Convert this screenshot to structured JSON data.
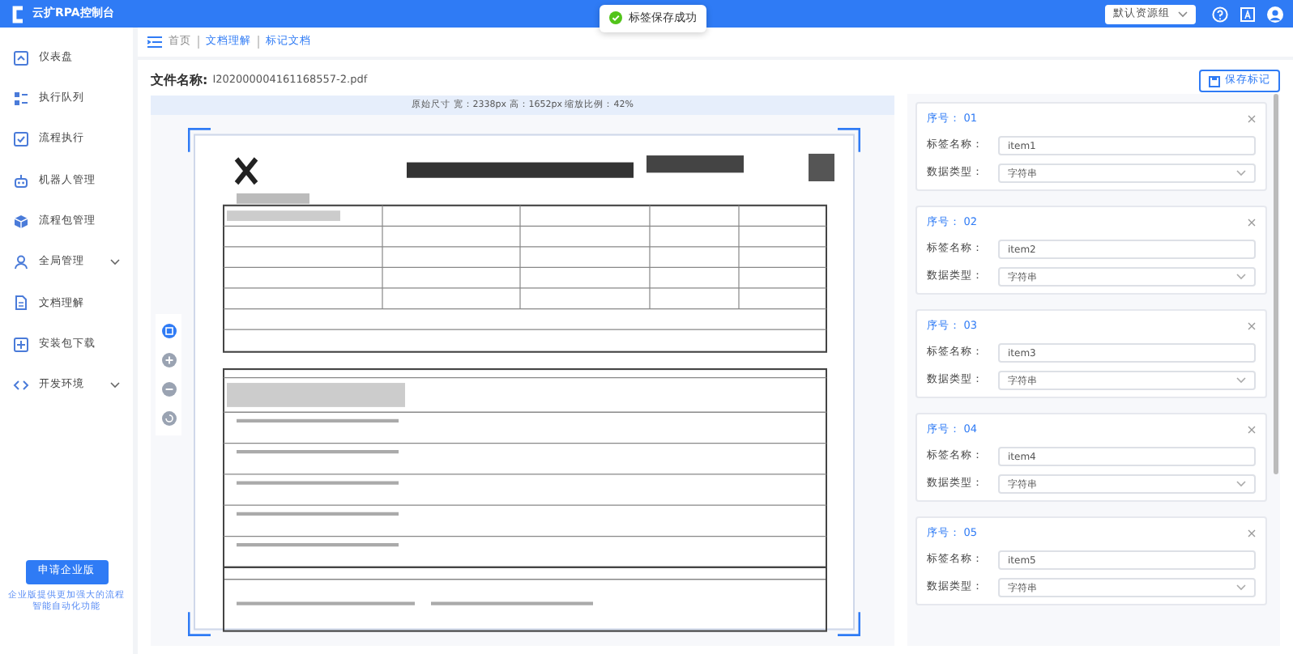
{
  "app": {
    "title": "云扩RPA控制台"
  },
  "toast": {
    "text": "标签保存成功"
  },
  "header": {
    "resource_group": "默认资源组"
  },
  "sidebar": {
    "items": [
      {
        "label": "仪表盘",
        "expandable": false
      },
      {
        "label": "执行队列",
        "expandable": false
      },
      {
        "label": "流程执行",
        "expandable": false
      },
      {
        "label": "机器人管理",
        "expandable": false
      },
      {
        "label": "流程包管理",
        "expandable": false
      },
      {
        "label": "全局管理",
        "expandable": true
      },
      {
        "label": "文档理解",
        "expandable": false
      },
      {
        "label": "安装包下载",
        "expandable": false
      },
      {
        "label": "开发环境",
        "expandable": true
      }
    ],
    "upgrade_button": "申请企业版",
    "upgrade_note": "企业版提供更加强大的流程智能自动化功能"
  },
  "breadcrumb": [
    {
      "label": "首页",
      "link": false
    },
    {
      "label": "文档理解",
      "link": true
    },
    {
      "label": "标记文档",
      "link": true
    }
  ],
  "file": {
    "label": "文件名称:",
    "name": "I202000004161168557-2.pdf"
  },
  "save_button": "保存标记",
  "image_info": "原始尺寸 宽：2338px 高：1652px 缩放比例：42%",
  "labels": [
    {
      "index_label": "序号：",
      "index": "01",
      "name_label": "标签名称：",
      "name": "item1",
      "type_label": "数据类型：",
      "type": "字符串"
    },
    {
      "index_label": "序号：",
      "index": "02",
      "name_label": "标签名称：",
      "name": "item2",
      "type_label": "数据类型：",
      "type": "字符串"
    },
    {
      "index_label": "序号：",
      "index": "03",
      "name_label": "标签名称：",
      "name": "item3",
      "type_label": "数据类型：",
      "type": "字符串"
    },
    {
      "index_label": "序号：",
      "index": "04",
      "name_label": "标签名称：",
      "name": "item4",
      "type_label": "数据类型：",
      "type": "字符串"
    },
    {
      "index_label": "序号：",
      "index": "05",
      "name_label": "标签名称：",
      "name": "item5",
      "type_label": "数据类型：",
      "type": "字符串"
    }
  ]
}
